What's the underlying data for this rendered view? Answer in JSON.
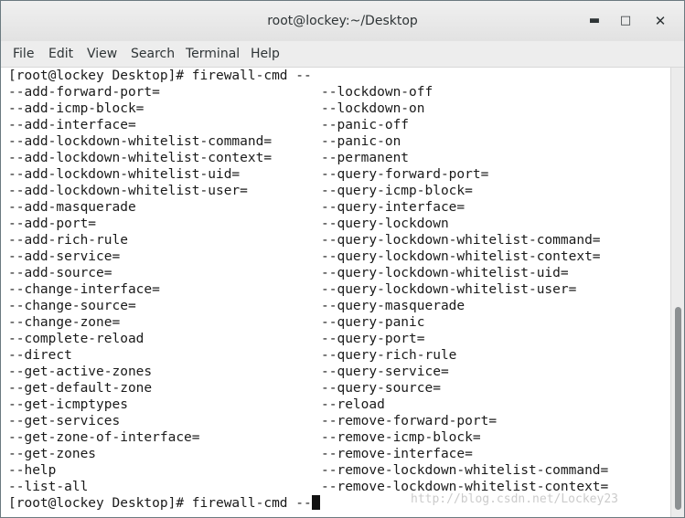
{
  "window": {
    "title": "root@lockey:~/Desktop",
    "minimize_icon": "minimize-icon",
    "maximize_icon": "maximize-icon",
    "close_icon": "close-icon"
  },
  "menu": [
    "File",
    "Edit",
    "View",
    "Search",
    "Terminal",
    "Help"
  ],
  "terminal": {
    "first_prompt": "[root@lockey Desktop]# firewall-cmd --",
    "left_column": [
      "--add-forward-port=",
      "--add-icmp-block=",
      "--add-interface=",
      "--add-lockdown-whitelist-command=",
      "--add-lockdown-whitelist-context=",
      "--add-lockdown-whitelist-uid=",
      "--add-lockdown-whitelist-user=",
      "--add-masquerade",
      "--add-port=",
      "--add-rich-rule",
      "--add-service=",
      "--add-source=",
      "--change-interface=",
      "--change-source=",
      "--change-zone=",
      "--complete-reload",
      "--direct",
      "--get-active-zones",
      "--get-default-zone",
      "--get-icmptypes",
      "--get-services",
      "--get-zone-of-interface=",
      "--get-zones",
      "--help",
      "--list-all"
    ],
    "right_column": [
      "--lockdown-off",
      "--lockdown-on",
      "--panic-off",
      "--panic-on",
      "--permanent",
      "--query-forward-port=",
      "--query-icmp-block=",
      "--query-interface=",
      "--query-lockdown",
      "--query-lockdown-whitelist-command=",
      "--query-lockdown-whitelist-context=",
      "--query-lockdown-whitelist-uid=",
      "--query-lockdown-whitelist-user=",
      "--query-masquerade",
      "--query-panic",
      "--query-port=",
      "--query-rich-rule",
      "--query-service=",
      "--query-source=",
      "--reload",
      "--remove-forward-port=",
      "--remove-icmp-block=",
      "--remove-interface=",
      "--remove-lockdown-whitelist-command=",
      "--remove-lockdown-whitelist-context="
    ],
    "last_prompt": "[root@lockey Desktop]# firewall-cmd --"
  },
  "watermark": "http://blog.csdn.net/Lockey23"
}
